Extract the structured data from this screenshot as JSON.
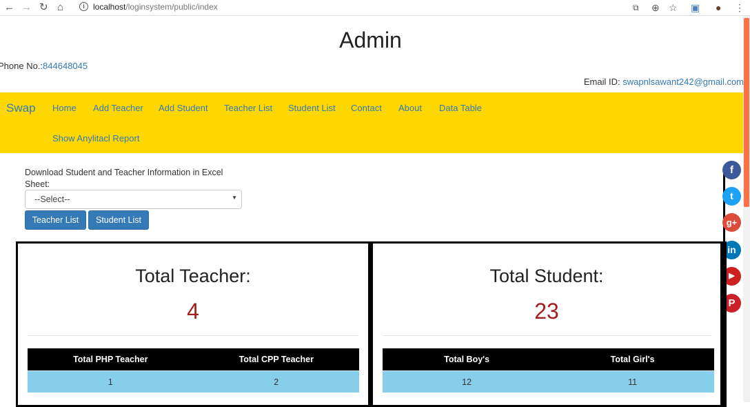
{
  "browser": {
    "url_host": "localhost",
    "url_path": "/loginsystem/public/index"
  },
  "header": {
    "title": "Admin",
    "phone_label": "Phone No.:",
    "phone_value": "844648045",
    "email_label": "Email ID:",
    "email_value": "swapnlsawant242@gmail.com"
  },
  "navbar": {
    "brand": "Swap",
    "items": [
      "Home",
      "Add Teacher",
      "Add Student",
      "Teacher List",
      "Student List",
      "Contact",
      "About",
      "Data Table",
      "Show Anylitacl Report"
    ]
  },
  "download": {
    "label": "Download Student and Teacher Information in Excel Sheet:",
    "select_value": "--Select--",
    "buttons": [
      "Teacher List",
      "Student List"
    ]
  },
  "social": [
    "facebook-icon",
    "twitter-icon",
    "google-plus-icon",
    "linkedin-icon",
    "youtube-icon",
    "pinterest-icon"
  ],
  "panels": {
    "teacher": {
      "title": "Total Teacher:",
      "count": "4",
      "headers": [
        "Total PHP Teacher",
        "Total CPP Teacher"
      ],
      "values": [
        "1",
        "2"
      ]
    },
    "student": {
      "title": "Total Student:",
      "count": "23",
      "headers": [
        "Total Boy's",
        "Total Girl's"
      ],
      "values": [
        "12",
        "11"
      ]
    }
  },
  "colors": {
    "navbar_bg": "#ffd700",
    "link": "#337ab7",
    "count": "#a02020",
    "table_head": "#000000",
    "table_row": "#87ceeb"
  }
}
